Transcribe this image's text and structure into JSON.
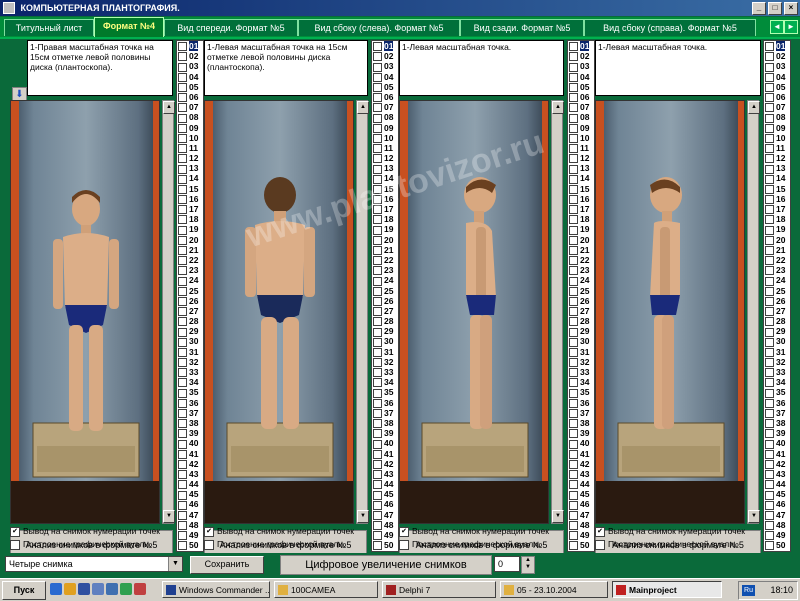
{
  "window": {
    "title": "КОМПЬЮТЕРНАЯ ПЛАНТОГРАФИЯ.",
    "buttons": [
      "_",
      "□",
      "×"
    ]
  },
  "tabs": [
    {
      "label": "Титульный лист"
    },
    {
      "label": "Формат №4",
      "active": true
    },
    {
      "label": "Вид спереди. Формат №5"
    },
    {
      "label": "Вид сбоку (слева). Формат №5"
    },
    {
      "label": "Вид сзади. Формат №5"
    },
    {
      "label": "Вид сбоку (справа). Формат №5"
    }
  ],
  "tab_nav": [
    "◄",
    "►"
  ],
  "panels": [
    {
      "description": "1-Правая масштабная точка на 15см отметке левой половины диска (плантоскопа).",
      "view": "front",
      "analysis_button": "Анализ снимков в  формате №5",
      "check_numbering": "Вывод на снимок нумерации точек",
      "check_numbering_checked": true,
      "check_graphic": "Построение графической вуали.",
      "check_graphic_checked": false
    },
    {
      "description": "1-Левая масштабная точка на 15см отметке левой половины диска (плантоскопа).",
      "view": "back",
      "analysis_button": "Анализ снимков в  формате №5",
      "check_numbering": "Вывод на снимок нумерации точек",
      "check_numbering_checked": true,
      "check_graphic": "Построение графической вуали.",
      "check_graphic_checked": false
    },
    {
      "description": "1-Левая масштабная точка.",
      "view": "left",
      "analysis_button": "Анализ снимков в  формате №5",
      "check_numbering": "Вывод на снимок нумерации точек",
      "check_numbering_checked": true,
      "check_graphic": "Построение графической вуали.",
      "check_graphic_checked": false
    },
    {
      "description": "1-Левая масштабная точка.",
      "view": "right",
      "analysis_button": "Анализ снимков в  формате №5",
      "check_numbering": "Вывод на снимок нумерации точек",
      "check_numbering_checked": true,
      "check_graphic": "Построение графической вуали.",
      "check_graphic_checked": false
    }
  ],
  "point_numbers": [
    "01",
    "02",
    "03",
    "04",
    "05",
    "06",
    "07",
    "08",
    "09",
    "10",
    "11",
    "12",
    "13",
    "14",
    "15",
    "16",
    "17",
    "18",
    "19",
    "20",
    "21",
    "22",
    "23",
    "24",
    "25",
    "26",
    "27",
    "28",
    "29",
    "30",
    "31",
    "32",
    "33",
    "34",
    "35",
    "36",
    "37",
    "38",
    "39",
    "40",
    "41",
    "42",
    "43",
    "44",
    "45",
    "46",
    "47",
    "48",
    "49",
    "50"
  ],
  "watermark": "www.plantovizor.ru",
  "bottom": {
    "combo_value": "Четыре снимка",
    "save_label": "Сохранить",
    "zoom_label": "Цифровое увеличение снимков",
    "zoom_value": "0"
  },
  "taskbar": {
    "start": "Пуск",
    "tasks": [
      {
        "label": "Windows Commander ...",
        "active": false
      },
      {
        "label": "100CAMEA",
        "active": false
      },
      {
        "label": "Delphi 7",
        "active": false
      },
      {
        "label": "05 - 23.10.2004",
        "active": false
      },
      {
        "label": "Mainproject",
        "active": true
      }
    ],
    "lang": "Ru",
    "clock": "18:10"
  },
  "colors": {
    "background": "#0a6a3a",
    "tab_active_text": "#ffff80",
    "selection": "#0a246a"
  }
}
